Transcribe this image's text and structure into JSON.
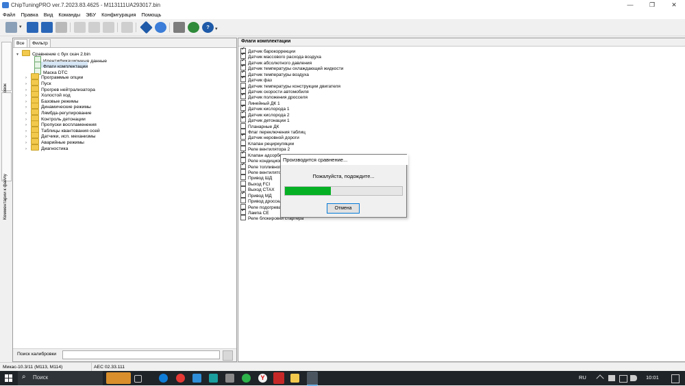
{
  "window": {
    "title": "ChipTuningPRO ver.7.2023.83.4625 - M113111UA293017.bin",
    "minimize": "—",
    "maximize": "❐",
    "close": "✕"
  },
  "menu": [
    "Файл",
    "Правка",
    "Вид",
    "Команды",
    "ЭБУ",
    "Конфигурация",
    "Помощь"
  ],
  "side_tabs": [
    "Меню калибровок",
    "Комментарии к файлу"
  ],
  "left_panel": {
    "tabs": [
      "Все",
      "Фильтр"
    ],
    "root": "Сравнение с бух скач 2.bin",
    "items": [
      {
        "label": "Идентификационные данные",
        "type": "doc"
      },
      {
        "label": "Флаги комплектации",
        "type": "doc",
        "selected": true
      },
      {
        "label": "Маска DTC",
        "type": "doc"
      },
      {
        "label": "Программые опции",
        "type": "folder"
      },
      {
        "label": "Пуск",
        "type": "folder"
      },
      {
        "label": "Прогрев нейтрализатора",
        "type": "folder"
      },
      {
        "label": "Холостой ход",
        "type": "folder"
      },
      {
        "label": "Базовые режимы",
        "type": "folder"
      },
      {
        "label": "Динамические режимы",
        "type": "folder"
      },
      {
        "label": "Лямбда-регулирование",
        "type": "folder"
      },
      {
        "label": "Контроль детонации",
        "type": "folder"
      },
      {
        "label": "Пропуски воспламенения",
        "type": "folder"
      },
      {
        "label": "Таблицы квантования осей",
        "type": "folder"
      },
      {
        "label": "Датчики, исп. механизмы",
        "type": "folder"
      },
      {
        "label": "Аварийные режимы",
        "type": "folder"
      },
      {
        "label": "Диагностика",
        "type": "folder"
      }
    ],
    "search_label": "Поиск калибровки",
    "search_value": ""
  },
  "right_panel": {
    "header": "Флаги комплектации",
    "flags": [
      {
        "label": "Датчик барокоррекции",
        "checked": true
      },
      {
        "label": "Датчик массового расхода воздуха",
        "checked": true
      },
      {
        "label": "Датчик абсолютного давления",
        "checked": true
      },
      {
        "label": "Датчик температуры охлаждающей жидкости",
        "checked": true
      },
      {
        "label": "Датчик температуры воздуха",
        "checked": true
      },
      {
        "label": "Датчик фаз",
        "checked": true
      },
      {
        "label": "Датчик температуры конструкции двигателя",
        "checked": false
      },
      {
        "label": "Датчик скорости автомобиля",
        "checked": true
      },
      {
        "label": "Датчик положения дросселя",
        "checked": true
      },
      {
        "label": "Линейный ДК 1",
        "checked": false
      },
      {
        "label": "Датчик кислорода 1",
        "checked": true
      },
      {
        "label": "Датчик кислорода 2",
        "checked": true
      },
      {
        "label": "Датчик детонации 1",
        "checked": true
      },
      {
        "label": "Планарные ДК",
        "checked": false
      },
      {
        "label": "Флаг переключения таблиц",
        "checked": false
      },
      {
        "label": "Датчик неровной дороги",
        "checked": true
      },
      {
        "label": "Клапан рециркуляции",
        "checked": false
      },
      {
        "label": "Реле вентилятора 2",
        "checked": false
      },
      {
        "label": "Клапан адсорбера",
        "checked": true
      },
      {
        "label": "Реле кондиционера",
        "checked": false
      },
      {
        "label": "Реле топливного насоса",
        "checked": true
      },
      {
        "label": "Реле вентилятора",
        "checked": false
      },
      {
        "label": "Привод ШД",
        "checked": false
      },
      {
        "label": "Выход FCI",
        "checked": false
      },
      {
        "label": "Выход СТАХ",
        "checked": false
      },
      {
        "label": "Привод МД",
        "checked": true
      },
      {
        "label": "Привод дросселя",
        "checked": false
      },
      {
        "label": "Реле подогрева",
        "checked": false
      },
      {
        "label": "Лампа CE",
        "checked": true
      },
      {
        "label": "Реле блокировки стартера",
        "checked": false
      }
    ]
  },
  "dialog": {
    "title": "Производится сравнение...",
    "message": "Пожалуйста, подождите...",
    "progress": 0.39,
    "cancel_label": "Отмена"
  },
  "status_bar": {
    "ecu": "Микас-10.3/11 (М113, М114)",
    "version": "AEC 02.33.111"
  },
  "taskbar": {
    "search_placeholder": "Поиск",
    "lang": "RU",
    "time": "10:01"
  },
  "colors": {
    "progress": "#06b025",
    "taskbar": "#1f2428",
    "selection": "#d7e7f6"
  }
}
